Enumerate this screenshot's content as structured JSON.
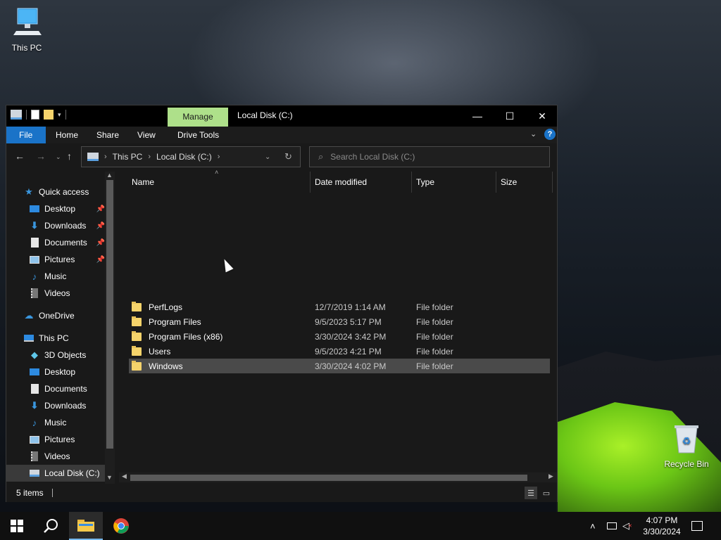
{
  "desktop": {
    "icons": [
      {
        "label": "This PC",
        "icon": "computer-icon"
      },
      {
        "label": "Recycle Bin",
        "icon": "recycle-bin-icon"
      }
    ]
  },
  "window": {
    "title": "Local Disk (C:)",
    "contextual_tab": "Manage",
    "controls": {
      "minimize": "—",
      "maximize": "☐",
      "close": "✕"
    },
    "ribbon_tabs": [
      "File",
      "Home",
      "Share",
      "View",
      "Drive Tools"
    ],
    "address": {
      "segments": [
        "This PC",
        "Local Disk (C:)"
      ]
    },
    "search": {
      "placeholder": "Search Local Disk (C:)"
    },
    "nav_pane": {
      "quick_access": "Quick access",
      "quick_items": [
        {
          "label": "Desktop",
          "icon": "desktop-icon"
        },
        {
          "label": "Downloads",
          "icon": "downloads-icon"
        },
        {
          "label": "Documents",
          "icon": "documents-icon"
        },
        {
          "label": "Pictures",
          "icon": "pictures-icon"
        },
        {
          "label": "Music",
          "icon": "music-icon"
        },
        {
          "label": "Videos",
          "icon": "videos-icon"
        }
      ],
      "onedrive": "OneDrive",
      "this_pc": "This PC",
      "pc_items": [
        {
          "label": "3D Objects",
          "icon": "3d-objects-icon"
        },
        {
          "label": "Desktop",
          "icon": "desktop-icon"
        },
        {
          "label": "Documents",
          "icon": "documents-icon"
        },
        {
          "label": "Downloads",
          "icon": "downloads-icon"
        },
        {
          "label": "Music",
          "icon": "music-icon"
        },
        {
          "label": "Pictures",
          "icon": "pictures-icon"
        },
        {
          "label": "Videos",
          "icon": "videos-icon"
        },
        {
          "label": "Local Disk (C:)",
          "icon": "drive-icon"
        }
      ]
    },
    "columns": [
      "Name",
      "Date modified",
      "Type",
      "Size"
    ],
    "files": [
      {
        "name": "PerfLogs",
        "date": "12/7/2019 1:14 AM",
        "type": "File folder"
      },
      {
        "name": "Program Files",
        "date": "9/5/2023 5:17 PM",
        "type": "File folder"
      },
      {
        "name": "Program Files (x86)",
        "date": "3/30/2024 3:42 PM",
        "type": "File folder"
      },
      {
        "name": "Users",
        "date": "9/5/2023 4:21 PM",
        "type": "File folder"
      },
      {
        "name": "Windows",
        "date": "3/30/2024 4:02 PM",
        "type": "File folder"
      }
    ],
    "selected_file": "Windows",
    "status": "5 items"
  },
  "taskbar": {
    "clock_time": "4:07 PM",
    "clock_date": "3/30/2024"
  },
  "colors": {
    "accent": "#1a73c8",
    "manage_tab": "#aee08a",
    "window_bg": "#191919",
    "folder": "#f5d36b"
  }
}
